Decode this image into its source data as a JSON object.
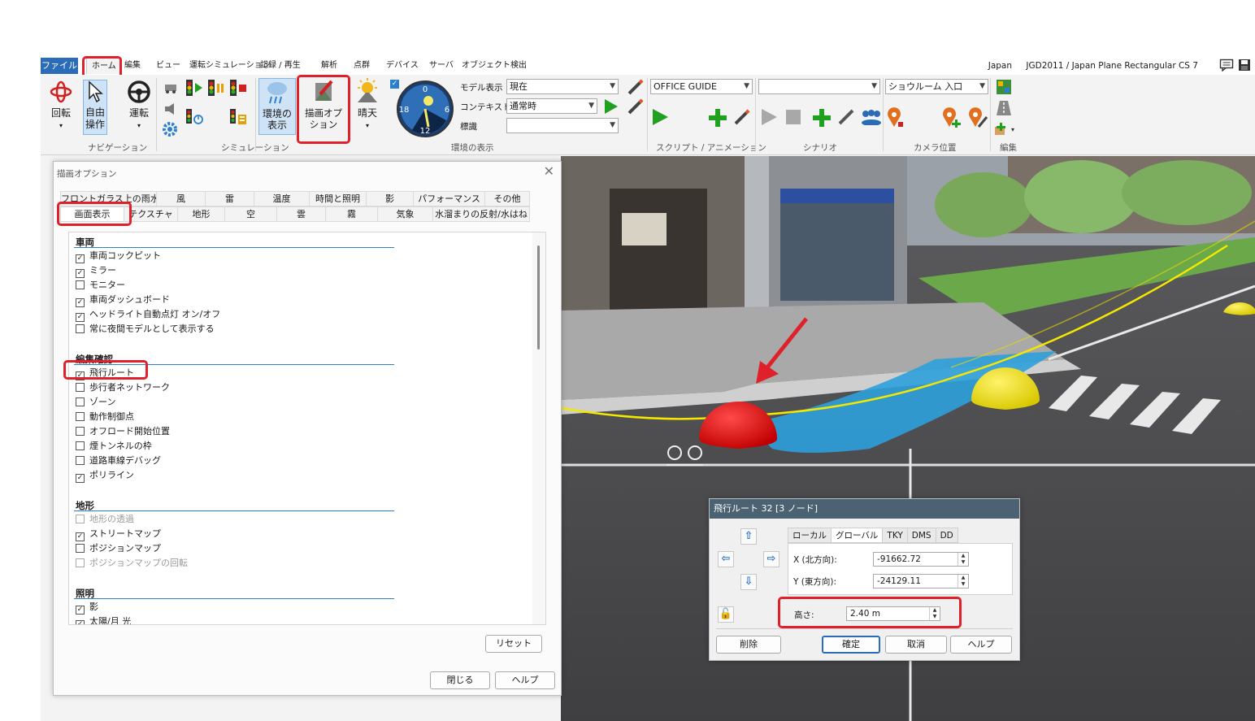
{
  "menu": {
    "file": "ファイル",
    "items": [
      "ホーム",
      "編集",
      "ビュー",
      "運転シミュレーション",
      "記録 / 再生",
      "解析",
      "点群",
      "デバイス",
      "サーバ",
      "オブジェクト検出"
    ],
    "region": "Japan",
    "crs": "JGD2011 / Japan Plane Rectangular CS 7"
  },
  "ribbon": {
    "nav": {
      "rotate": "回転",
      "free": "自由操作",
      "drive": "運転",
      "group": "ナビゲーション"
    },
    "sim": {
      "group": "シミュレーション"
    },
    "env": {
      "env_display": "環境の表示",
      "draw_options": "描画オプション",
      "weather": "晴天",
      "clock": [
        "0",
        "6",
        "12",
        "18"
      ],
      "model_label": "モデル表示",
      "model_value": "現在",
      "context_label": "コンテキスト",
      "context_value": "通常時",
      "sign_label": "標識",
      "sign_value": "",
      "group": "環境の表示"
    },
    "script": {
      "combo": "OFFICE GUIDE",
      "group": "スクリプト / アニメーション"
    },
    "scenario": {
      "combo": "",
      "group": "シナリオ"
    },
    "camera": {
      "combo": "ショウルーム 入口",
      "group": "カメラ位置"
    },
    "edit": {
      "group": "編集"
    }
  },
  "draw_dialog": {
    "title": "描画オプション",
    "tabs_row1": [
      "フロントガラス上の雨水",
      "風",
      "雷",
      "温度",
      "時間と照明",
      "影",
      "パフォーマンス",
      "その他"
    ],
    "tabs_row2": [
      "画面表示",
      "テクスチャ",
      "地形",
      "空",
      "雲",
      "霧",
      "気象",
      "水溜まりの反射/水はね"
    ],
    "sections": [
      {
        "heading": "車両",
        "options": [
          {
            "label": "車両コックピット",
            "checked": true
          },
          {
            "label": "ミラー",
            "checked": true
          },
          {
            "label": "モニター",
            "checked": false
          },
          {
            "label": "車両ダッシュボード",
            "checked": true
          },
          {
            "label": "ヘッドライト自動点灯 オン/オフ",
            "checked": true
          },
          {
            "label": "常に夜間モデルとして表示する",
            "checked": false
          }
        ]
      },
      {
        "heading": "編集確認",
        "options": [
          {
            "label": "飛行ルート",
            "checked": true
          },
          {
            "label": "歩行者ネットワーク",
            "checked": false
          },
          {
            "label": "ゾーン",
            "checked": false
          },
          {
            "label": "動作制御点",
            "checked": false
          },
          {
            "label": "オフロード開始位置",
            "checked": false
          },
          {
            "label": "煙トンネルの枠",
            "checked": false
          },
          {
            "label": "道路車線デバッグ",
            "checked": false
          },
          {
            "label": "ポリライン",
            "checked": true
          }
        ]
      },
      {
        "heading": "地形",
        "options": [
          {
            "label": "地形の透過",
            "checked": false,
            "disabled": true
          },
          {
            "label": "ストリートマップ",
            "checked": true
          },
          {
            "label": "ポジションマップ",
            "checked": false
          },
          {
            "label": "ポジションマップの回転",
            "checked": false,
            "disabled": true
          }
        ]
      },
      {
        "heading": "照明",
        "options": [
          {
            "label": "影",
            "checked": true
          },
          {
            "label": "太陽/月 光",
            "checked": true
          }
        ]
      }
    ],
    "reset": "リセット",
    "close": "閉じる",
    "help": "ヘルプ"
  },
  "flight_dialog": {
    "title": "飛行ルート 32 [3 ノード]",
    "tabs": [
      "ローカル",
      "グローバル",
      "TKY",
      "DMS",
      "DD"
    ],
    "x_label": "X (北方向):",
    "x_value": "-91662.72",
    "y_label": "Y (東方向):",
    "y_value": "-24129.11",
    "height_label": "高さ:",
    "height_value": "2.40 m",
    "delete": "削除",
    "ok": "確定",
    "cancel": "取消",
    "help": "ヘルプ"
  },
  "colors": {
    "accent": "#2b6cb8",
    "highlight": "#e0202a",
    "section_line": "#2b7fcf"
  }
}
